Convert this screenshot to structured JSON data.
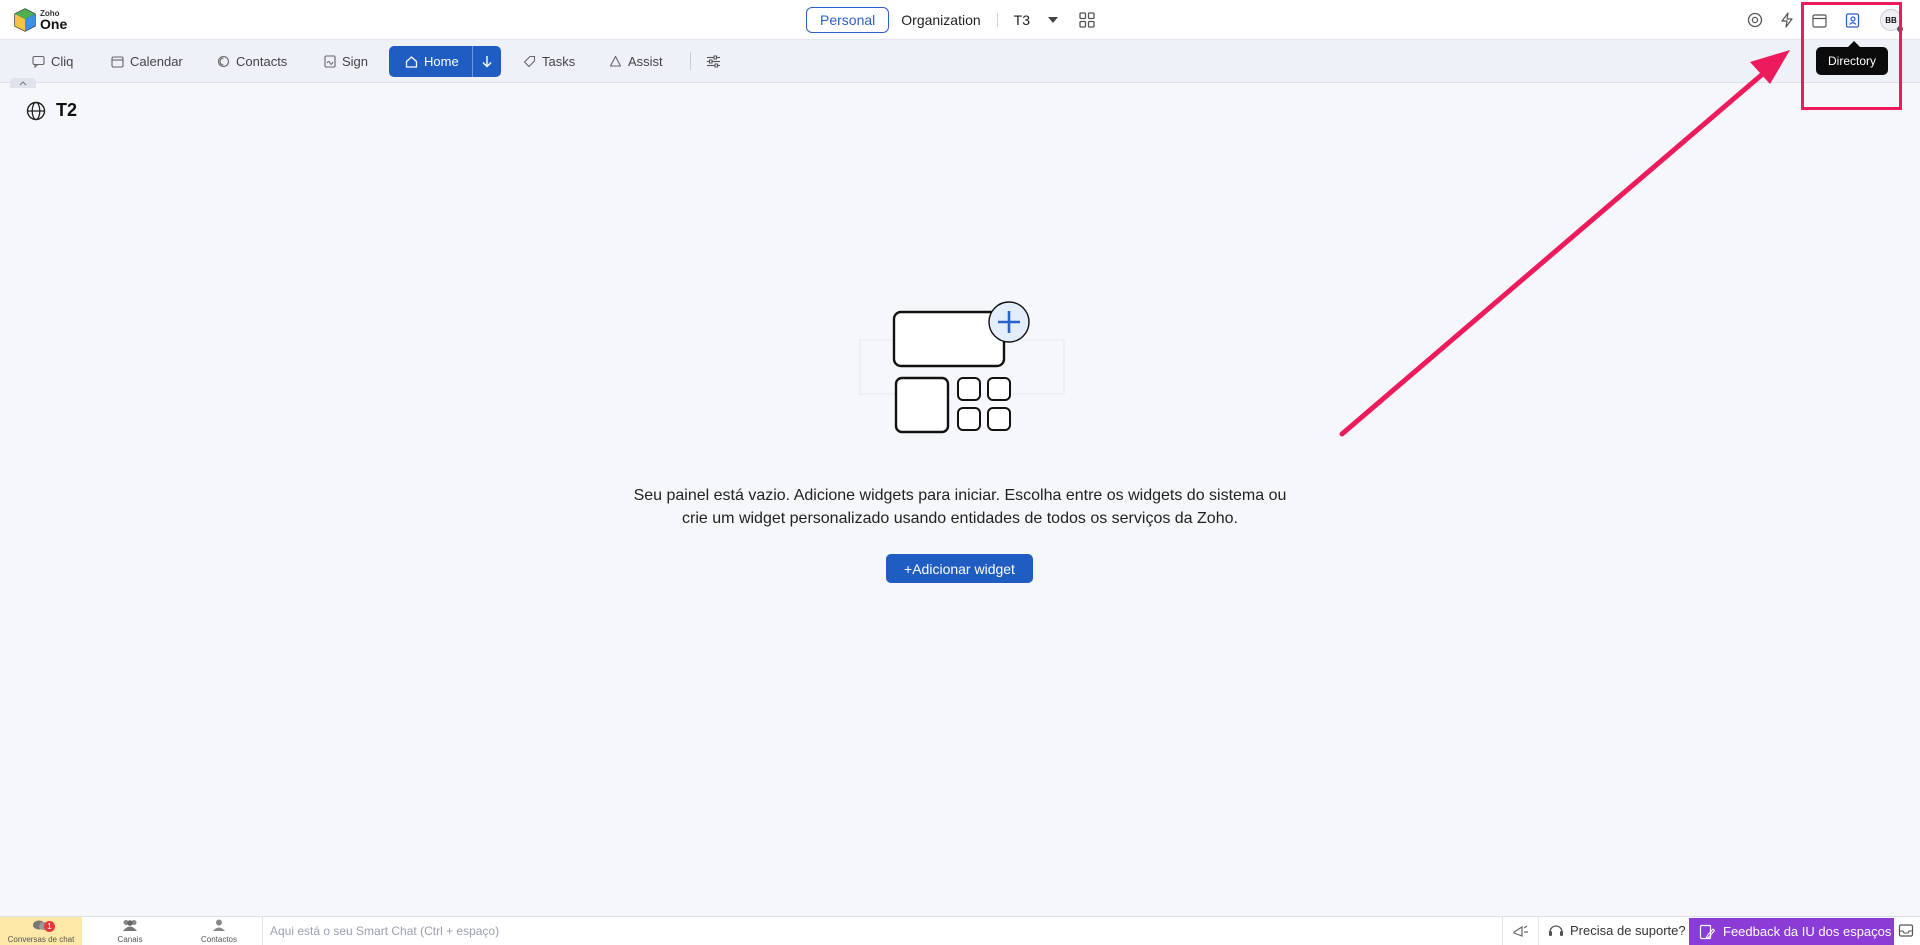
{
  "app": {
    "logo_small": "Zoho",
    "logo_big": "One"
  },
  "spaces": {
    "personal": "Personal",
    "organization": "Organization",
    "current": "T3"
  },
  "tooltip": "Directory",
  "avatar_initials": "BB",
  "nav": {
    "items": [
      "Cliq",
      "Calendar",
      "Contacts",
      "Sign",
      "Home",
      "Tasks",
      "Assist"
    ]
  },
  "page": {
    "title": "T2"
  },
  "empty_state": {
    "line1": "Seu painel está vazio. Adicione widgets para iniciar. Escolha entre os widgets do sistema ou",
    "line2": "crie um widget personalizado usando entidades de todos os serviços da Zoho.",
    "button": "+Adicionar widget"
  },
  "bottom": {
    "chat_label": "Conversas de chat",
    "chat_badge": "1",
    "channels_label": "Canais",
    "contacts_label": "Contactos",
    "smart_chat_placeholder": "Aqui está o seu Smart Chat (Ctrl + espaço)",
    "support": "Precisa de suporte?",
    "feedback": "Feedback da IU dos espaços"
  },
  "colors": {
    "accent": "#1f5dc2",
    "annotation": "#ee1b5c",
    "feedback": "#8b3bd6"
  }
}
